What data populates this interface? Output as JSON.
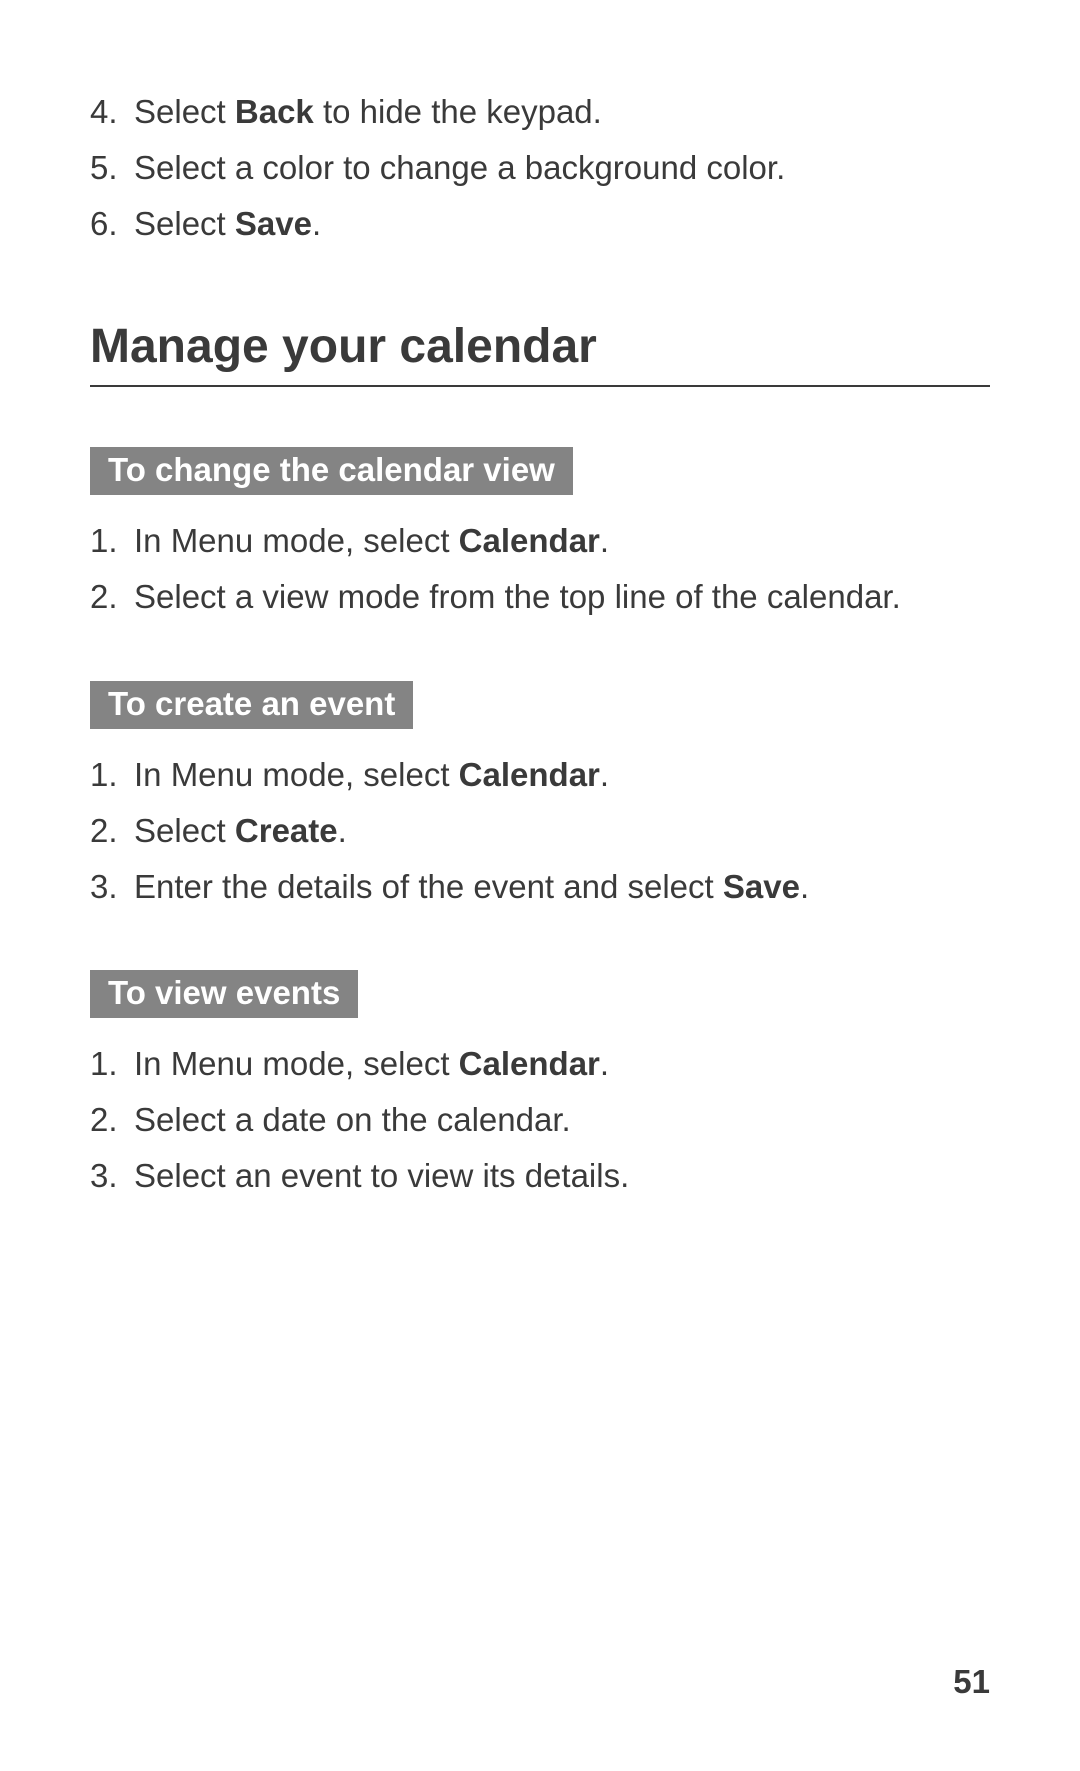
{
  "continued_steps": [
    {
      "n": "4.",
      "parts": [
        {
          "t": "Select "
        },
        {
          "t": "Back",
          "b": true
        },
        {
          "t": " to hide the keypad."
        }
      ]
    },
    {
      "n": "5.",
      "parts": [
        {
          "t": "Select a color to change a background color."
        }
      ]
    },
    {
      "n": "6.",
      "parts": [
        {
          "t": "Select "
        },
        {
          "t": "Save",
          "b": true
        },
        {
          "t": "."
        }
      ]
    }
  ],
  "section_heading": "Manage your calendar",
  "subsections": [
    {
      "title": "To change the calendar view",
      "steps": [
        {
          "n": "1.",
          "parts": [
            {
              "t": "In Menu mode, select "
            },
            {
              "t": "Calendar",
              "b": true
            },
            {
              "t": "."
            }
          ]
        },
        {
          "n": "2.",
          "parts": [
            {
              "t": "Select a view mode from the top line of the calendar."
            }
          ]
        }
      ]
    },
    {
      "title": "To create an event",
      "steps": [
        {
          "n": "1.",
          "parts": [
            {
              "t": "In Menu mode, select "
            },
            {
              "t": "Calendar",
              "b": true
            },
            {
              "t": "."
            }
          ]
        },
        {
          "n": "2.",
          "parts": [
            {
              "t": "Select "
            },
            {
              "t": "Create",
              "b": true
            },
            {
              "t": "."
            }
          ]
        },
        {
          "n": "3.",
          "parts": [
            {
              "t": "Enter the details of the event and select "
            },
            {
              "t": "Save",
              "b": true
            },
            {
              "t": "."
            }
          ]
        }
      ]
    },
    {
      "title": "To view events",
      "steps": [
        {
          "n": "1.",
          "parts": [
            {
              "t": "In Menu mode, select "
            },
            {
              "t": "Calendar",
              "b": true
            },
            {
              "t": "."
            }
          ]
        },
        {
          "n": "2.",
          "parts": [
            {
              "t": "Select a date on the calendar."
            }
          ]
        },
        {
          "n": "3.",
          "parts": [
            {
              "t": "Select an event to view its details."
            }
          ]
        }
      ]
    }
  ],
  "page_number": "51"
}
